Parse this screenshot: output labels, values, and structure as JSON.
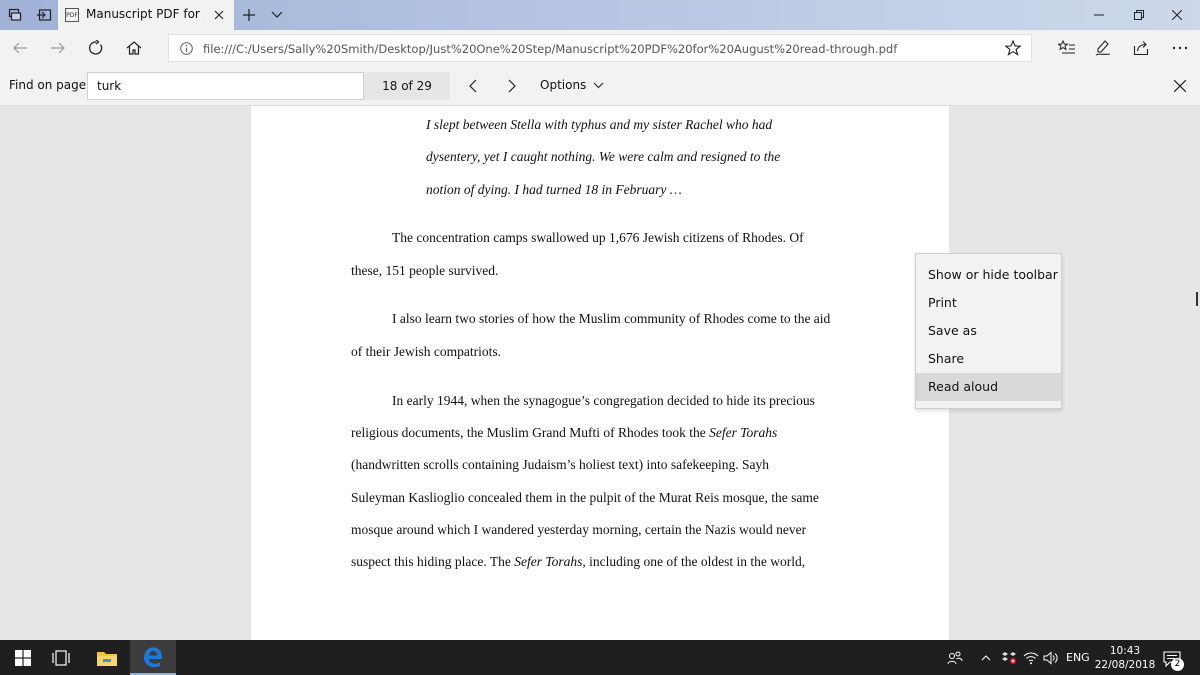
{
  "tab": {
    "title": "Manuscript PDF for August read-through.pdf"
  },
  "address": {
    "url": "file:///C:/Users/Sally%20Smith/Desktop/Just%20One%20Step/Manuscript%20PDF%20for%20August%20read-through.pdf"
  },
  "find": {
    "label": "Find on page",
    "query": "turk",
    "count": "18 of 29",
    "options_label": "Options"
  },
  "document": {
    "quote_lines": [
      "I slept between Stella with typhus and my sister Rachel who had",
      "dysentery, yet I caught nothing.  We were calm and resigned to the",
      "notion of dying.  I had turned 18 in February …"
    ],
    "para1_lines": [
      "The concentration camps swallowed up 1,676 Jewish citizens of Rhodes.  Of",
      "these, 151 people survived."
    ],
    "para2_lines": [
      "I also learn two stories of how the Muslim community of Rhodes come to the aid",
      "of their Jewish compatriots."
    ],
    "para3": {
      "l1": "In early 1944, when the synagogue’s congregation decided to hide its precious",
      "l2a": "religious documents, the Muslim Grand Mufti of Rhodes took the ",
      "l2b": "Sefer Torahs",
      "l3": "(handwritten scrolls containing Judaism’s holiest text) into safekeeping.  Sayh",
      "l4": "Suleyman Kaslioglio concealed them in the pulpit of the Murat Reis mosque, the same",
      "l5": "mosque around which I wandered yesterday morning, certain the Nazis would never",
      "l6a": "suspect this hiding place.  The ",
      "l6b": "Sefer Torahs",
      "l6c": ", including one of the oldest in the world,"
    }
  },
  "context_menu": {
    "items": [
      "Show or hide toolbar",
      "Print",
      "Save as",
      "Share",
      "Read aloud"
    ],
    "highlighted_index": 4
  },
  "taskbar": {
    "language": "ENG",
    "time": "10:43",
    "date": "22/08/2018",
    "notifications": "2"
  },
  "colors": {
    "edge_blue": "#1e78d7",
    "title_gradient_start": "#9fb2d6",
    "taskbar_bg": "#1f1f1f"
  }
}
